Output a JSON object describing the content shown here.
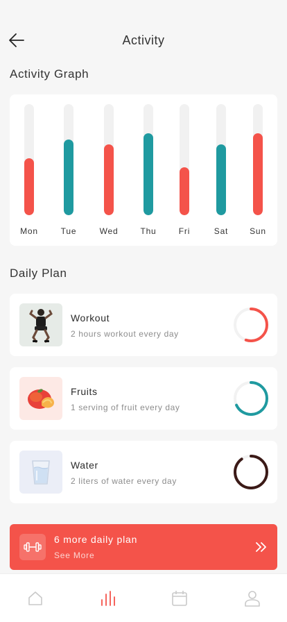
{
  "header": {
    "title": "Activity"
  },
  "graph": {
    "title": "Activity Graph"
  },
  "chart_data": {
    "type": "bar",
    "categories": [
      "Mon",
      "Tue",
      "Wed",
      "Thu",
      "Fri",
      "Sat",
      "Sun"
    ],
    "values": [
      0.51,
      0.68,
      0.64,
      0.74,
      0.43,
      0.64,
      0.74
    ],
    "colors": [
      "#f4534a",
      "#1f9aa0",
      "#f4534a",
      "#1f9aa0",
      "#f4534a",
      "#1f9aa0",
      "#f4534a"
    ],
    "ylim": [
      0,
      1
    ],
    "grid": false
  },
  "daily": {
    "title": "Daily Plan",
    "items": [
      {
        "title": "Workout",
        "subtitle": "2 hours workout every day",
        "progress": 0.55,
        "color": "#f4534a",
        "thumb_bg": "#e6ebe7",
        "icon": "workout-photo-icon"
      },
      {
        "title": "Fruits",
        "subtitle": "1 serving of fruit every day",
        "progress": 0.68,
        "color": "#1f9aa0",
        "thumb_bg": "#fde9e5",
        "icon": "peach-icon"
      },
      {
        "title": "Water",
        "subtitle": "2 liters of water every day",
        "progress": 0.9,
        "color": "#3b1a17",
        "thumb_bg": "#ebeef7",
        "icon": "water-glass-icon"
      }
    ]
  },
  "more": {
    "title": "6 more daily plan",
    "subtitle": "See More"
  },
  "tabs": [
    {
      "name": "home",
      "icon": "home-icon",
      "active": false
    },
    {
      "name": "activity",
      "icon": "bar-chart-icon",
      "active": true
    },
    {
      "name": "calendar",
      "icon": "calendar-icon",
      "active": false
    },
    {
      "name": "profile",
      "icon": "user-icon",
      "active": false
    }
  ],
  "colors": {
    "accent": "#f4534a",
    "teal": "#1f9aa0",
    "inactive": "#c9c9c9"
  }
}
